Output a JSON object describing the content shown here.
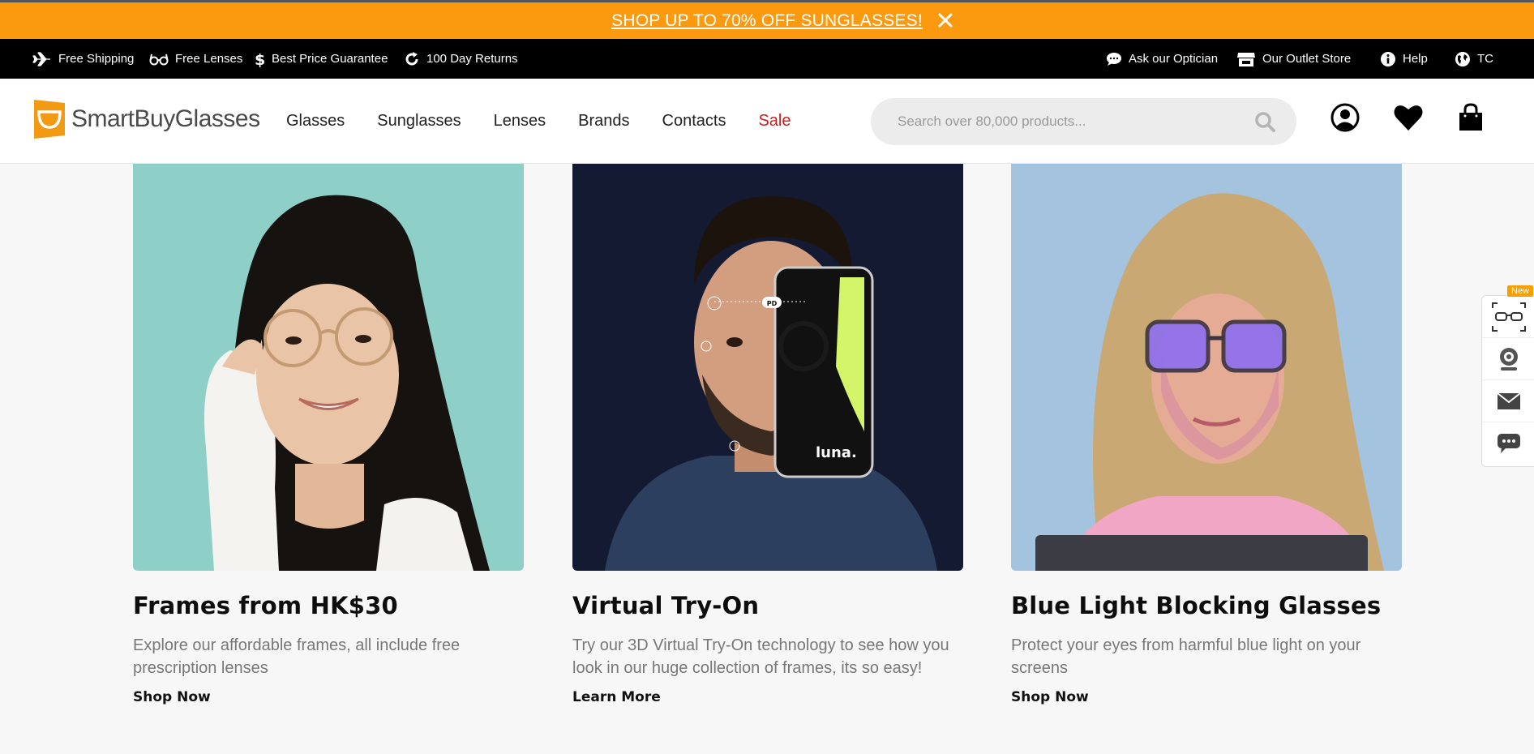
{
  "promo": {
    "text": "SHOP UP TO 70% OFF SUNGLASSES!"
  },
  "utility": {
    "left": [
      {
        "label": "Free Shipping",
        "icon": "plane-icon"
      },
      {
        "label": "Free Lenses",
        "icon": "glasses-icon"
      },
      {
        "label": "Best Price Guarantee",
        "icon": "dollar-icon"
      },
      {
        "label": "100 Day Returns",
        "icon": "return-icon"
      }
    ],
    "right": [
      {
        "label": "Ask our Optician",
        "icon": "chat-bubble-icon"
      },
      {
        "label": "Our Outlet Store",
        "icon": "store-icon"
      },
      {
        "label": "Help",
        "icon": "info-icon"
      },
      {
        "label": "TC",
        "icon": "globe-icon"
      }
    ]
  },
  "header": {
    "logo": "SmartBuyGlasses",
    "nav": [
      "Glasses",
      "Sunglasses",
      "Lenses",
      "Brands",
      "Contacts",
      "Sale"
    ],
    "search_placeholder": "Search over 80,000 products...",
    "brand_color": "#fb9a0f",
    "sale_color": "#c81e1e"
  },
  "cards": [
    {
      "title": "Frames from HK$30",
      "description": "Explore our affordable frames, all include free prescription lenses",
      "cta": "Shop Now",
      "bg": "#8ecfc7"
    },
    {
      "title": "Virtual Try-On",
      "description": "Try our 3D Virtual Try-On technology to see how you look in our huge collection of frames, its so easy!",
      "cta": "Learn More",
      "bg": "#151a33",
      "phone_brand": "luna.",
      "phone_label": "PD"
    },
    {
      "title": "Blue Light Blocking Glasses",
      "description": "Protect your eyes from harmful blue light on your screens",
      "cta": "Shop Now",
      "bg": "#a3c3de"
    }
  ],
  "sidebar": {
    "badge": "New",
    "items": [
      "face-scan-glasses-icon",
      "webcam-icon",
      "mail-icon",
      "chat-icon"
    ]
  }
}
